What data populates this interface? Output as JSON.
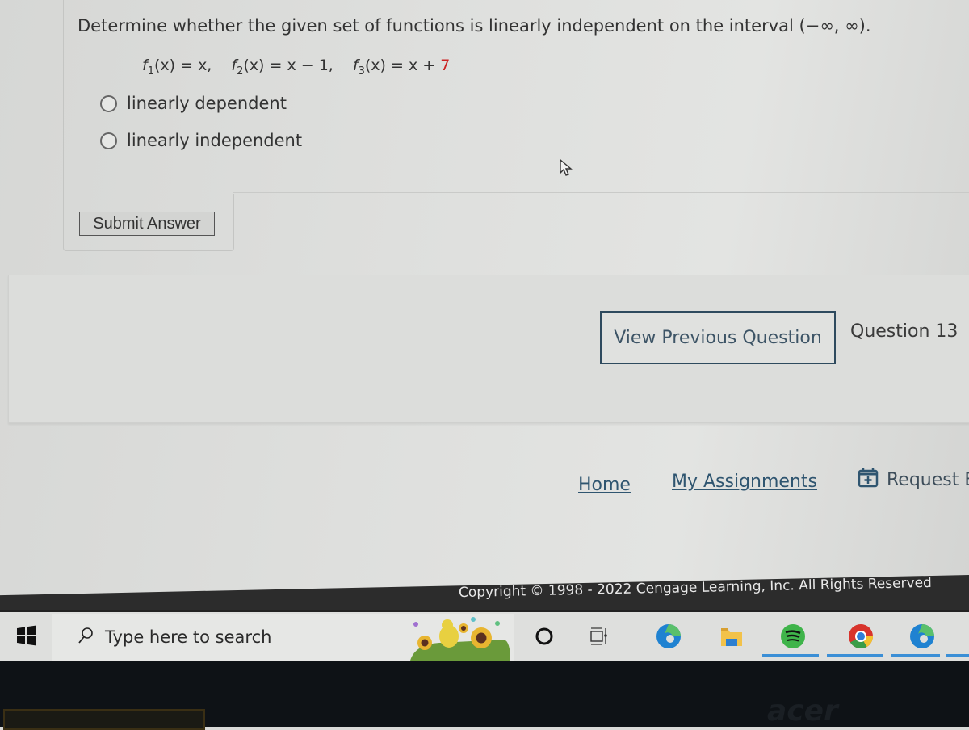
{
  "question": {
    "prompt": "Determine whether the given set of functions is linearly independent on the interval (−∞, ∞).",
    "functions": [
      {
        "name": "f",
        "sub": "1",
        "expr_lhs": "(x) = ",
        "expr_rhs": "x,",
        "highlight": ""
      },
      {
        "name": "f",
        "sub": "2",
        "expr_lhs": "(x) = ",
        "expr_rhs": "x − 1,",
        "highlight": ""
      },
      {
        "name": "f",
        "sub": "3",
        "expr_lhs": "(x) = ",
        "expr_rhs": "x + ",
        "highlight": "7"
      }
    ],
    "options": [
      {
        "label": "linearly dependent",
        "selected": false
      },
      {
        "label": "linearly independent",
        "selected": false
      }
    ],
    "submit_label": "Submit Answer"
  },
  "navigation": {
    "prev_label": "View Previous Question",
    "question_label": "Question 13"
  },
  "footer": {
    "links": [
      {
        "label": "Home"
      },
      {
        "label": "My Assignments"
      }
    ],
    "request_label": "Request E",
    "copyright": "Copyright © 1998 - 2022 Cengage Learning, Inc. All Rights Reserved"
  },
  "taskbar": {
    "search_placeholder": "Type here to search",
    "icons": [
      "windows-start",
      "search-highlight-illustration",
      "cortana",
      "task-view",
      "edge",
      "file-explorer",
      "spotify",
      "chrome",
      "edge-2"
    ]
  },
  "colors": {
    "accent": "#2e4a5e",
    "link": "#2f5570",
    "highlight_red": "#cc2222",
    "copyright_bar": "#2c2c2c"
  },
  "device_brand": "acer"
}
